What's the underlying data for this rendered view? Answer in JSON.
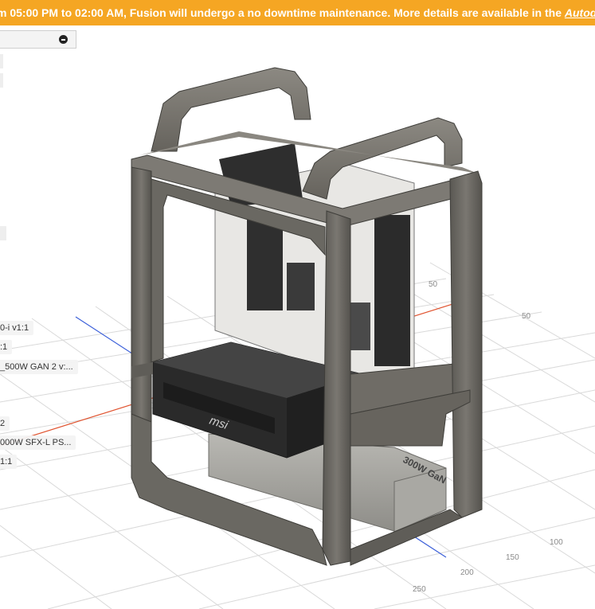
{
  "banner": {
    "message": "m 05:00 PM to 02:00 AM, Fusion will undergo a no downtime maintenance. More details are available in the ",
    "link_text": "Autodesk"
  },
  "browser": {
    "components": [
      "0-i v1:1",
      ":1",
      "_500W GAN 2 v:...",
      "2",
      "000W SFX-L PS...",
      "1:1"
    ]
  },
  "grid": {
    "ticks": [
      "50",
      "50",
      "100",
      "150",
      "200",
      "250"
    ]
  },
  "model": {
    "gpu_brand": "msi",
    "psu_text": "300W GaN"
  },
  "colors": {
    "banner": "#f5a623",
    "frame": "#6f6c66",
    "x_axis": "#e0532f",
    "z_axis": "#3b5fd9"
  }
}
